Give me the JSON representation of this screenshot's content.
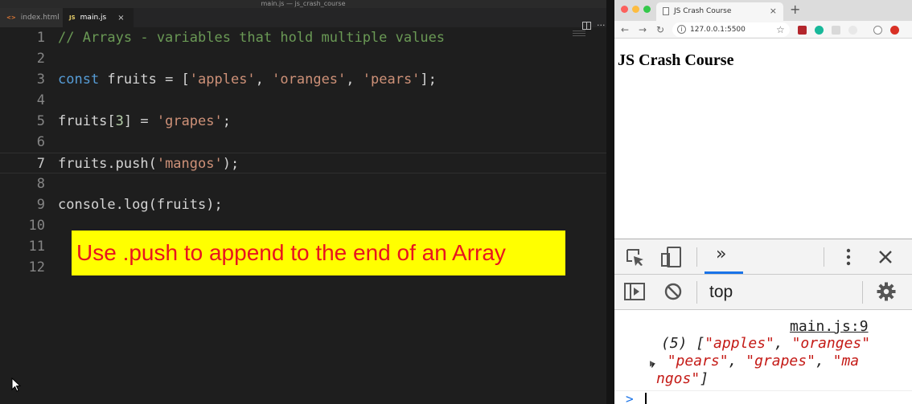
{
  "editor": {
    "window_title": "main.js — js_crash_course",
    "tabs": [
      {
        "label": "index.html",
        "icon": "<>"
      },
      {
        "label": "main.js",
        "icon": "JS",
        "close": "×"
      }
    ],
    "lines": [
      {
        "num": "1",
        "tokens": [
          {
            "t": "// Arrays - variables that hold multiple values",
            "c": "cmt"
          }
        ]
      },
      {
        "num": "2",
        "tokens": []
      },
      {
        "num": "3",
        "tokens": [
          {
            "t": "const",
            "c": "kw"
          },
          {
            "t": " fruits = [",
            "c": "var"
          },
          {
            "t": "'apples'",
            "c": "str"
          },
          {
            "t": ", ",
            "c": "var"
          },
          {
            "t": "'oranges'",
            "c": "str"
          },
          {
            "t": ", ",
            "c": "var"
          },
          {
            "t": "'pears'",
            "c": "str"
          },
          {
            "t": "];",
            "c": "var"
          }
        ]
      },
      {
        "num": "4",
        "tokens": []
      },
      {
        "num": "5",
        "tokens": [
          {
            "t": "fruits[",
            "c": "var"
          },
          {
            "t": "3",
            "c": "num"
          },
          {
            "t": "] = ",
            "c": "var"
          },
          {
            "t": "'grapes'",
            "c": "str"
          },
          {
            "t": ";",
            "c": "var"
          }
        ]
      },
      {
        "num": "6",
        "tokens": []
      },
      {
        "num": "7",
        "tokens": [
          {
            "t": "fruits.push(",
            "c": "var"
          },
          {
            "t": "'mangos'",
            "c": "str"
          },
          {
            "t": ");",
            "c": "var"
          }
        ]
      },
      {
        "num": "8",
        "tokens": []
      },
      {
        "num": "9",
        "tokens": [
          {
            "t": "console.log(fruits);",
            "c": "var"
          }
        ]
      },
      {
        "num": "10",
        "tokens": []
      },
      {
        "num": "11",
        "tokens": []
      },
      {
        "num": "12",
        "tokens": []
      }
    ],
    "active_line": "7",
    "banner": "Use .push to append to the end of an Array"
  },
  "browser": {
    "tab_title": "JS Crash Course",
    "tab_close": "×",
    "new_tab": "+",
    "url": "127.0.0.1:5500",
    "page_heading": "JS Crash Course"
  },
  "devtools": {
    "context": "top",
    "more_tabs": "»",
    "source_link": "main.js:9",
    "log_line1_prefix": "(5) [",
    "log_line1_s1": "\"apples\"",
    "log_line1_sep": ", ",
    "log_line1_s2": "\"oranges\"",
    "log_line2_s1": "\"pears\"",
    "log_line2_s2": "\"grapes\"",
    "log_line2_s3": "\"ma",
    "log_line3_s1": "ngos\"",
    "log_line3_end": "]",
    "prompt": ">"
  },
  "colors": {
    "keyword": "#569cd6",
    "string": "#ce9178",
    "comment": "#6a9955",
    "banner_bg": "#ffff00",
    "banner_text": "#e8141f"
  }
}
